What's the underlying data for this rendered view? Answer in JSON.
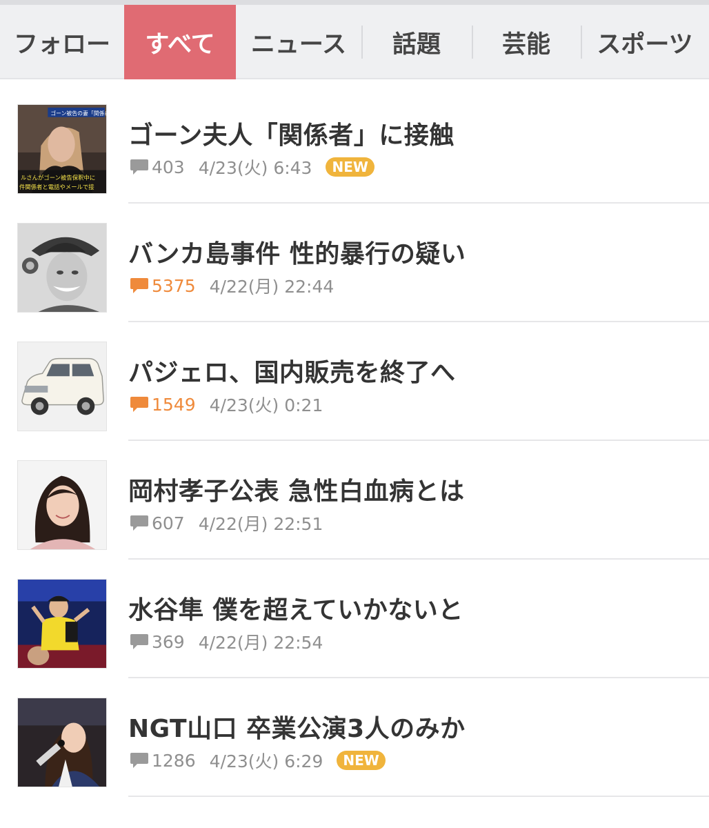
{
  "tabs": [
    {
      "label": "フォロー",
      "active": false
    },
    {
      "label": "すべて",
      "active": true
    },
    {
      "label": "ニュース",
      "active": false
    },
    {
      "label": "話題",
      "active": false
    },
    {
      "label": "芸能",
      "active": false
    },
    {
      "label": "スポーツ",
      "active": false
    }
  ],
  "articles": [
    {
      "title": "ゴーン夫人「関係者」に接触",
      "comments": "403",
      "date": "4/23(火) 6:43",
      "badge": "NEW",
      "hot": false,
      "thumb_icon": "news-photo-woman-icon",
      "thumb_caption": [
        "ゴーン被告の妻「関係者」",
        "ルさんがゴーン被告保釈中に",
        "件関係者と電話やメールで接"
      ]
    },
    {
      "title": "バンカ島事件 性的暴行の疑い",
      "comments": "5375",
      "date": "4/22(月) 22:44",
      "badge": "",
      "hot": true,
      "thumb_icon": "photo-woman-hat-icon"
    },
    {
      "title": "パジェロ、国内販売を終了へ",
      "comments": "1549",
      "date": "4/23(火) 0:21",
      "badge": "",
      "hot": true,
      "thumb_icon": "car-photo-icon"
    },
    {
      "title": "岡村孝子公表 急性白血病とは",
      "comments": "607",
      "date": "4/22(月) 22:51",
      "badge": "",
      "hot": false,
      "thumb_icon": "portrait-woman-icon"
    },
    {
      "title": "水谷隼 僕を超えていかないと",
      "comments": "369",
      "date": "4/22(月) 22:54",
      "badge": "",
      "hot": false,
      "thumb_icon": "table-tennis-player-icon"
    },
    {
      "title": "NGT山口 卒業公演3人のみか",
      "comments": "1286",
      "date": "4/23(火) 6:29",
      "badge": "NEW",
      "hot": false,
      "thumb_icon": "singer-photo-icon"
    }
  ],
  "colors": {
    "active_tab": "#e06b73",
    "hot_comment": "#ef8a3b",
    "normal_comment": "#8f8f8f",
    "new_badge": "#f0b43c"
  }
}
